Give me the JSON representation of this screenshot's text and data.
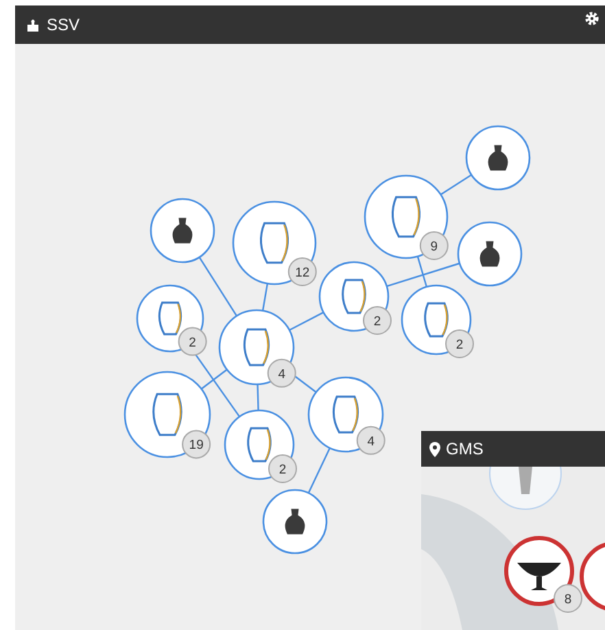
{
  "panel": {
    "title": "SSV"
  },
  "nodes": [
    {
      "kind": "photo"
    },
    {
      "kind": "outline",
      "count": "9"
    },
    {
      "kind": "photo"
    },
    {
      "kind": "photo"
    },
    {
      "kind": "outline",
      "count": "12"
    },
    {
      "kind": "outline",
      "count": "2"
    },
    {
      "kind": "outline",
      "count": "2"
    },
    {
      "kind": "outline",
      "count": "2"
    },
    {
      "kind": "outline",
      "count": "4"
    },
    {
      "kind": "outline",
      "count": "19"
    },
    {
      "kind": "outline",
      "count": "2"
    },
    {
      "kind": "outline",
      "count": "4"
    },
    {
      "kind": "photo"
    }
  ],
  "map_panel": {
    "title": "GMS",
    "nodes": [
      {
        "count": "8"
      }
    ]
  }
}
